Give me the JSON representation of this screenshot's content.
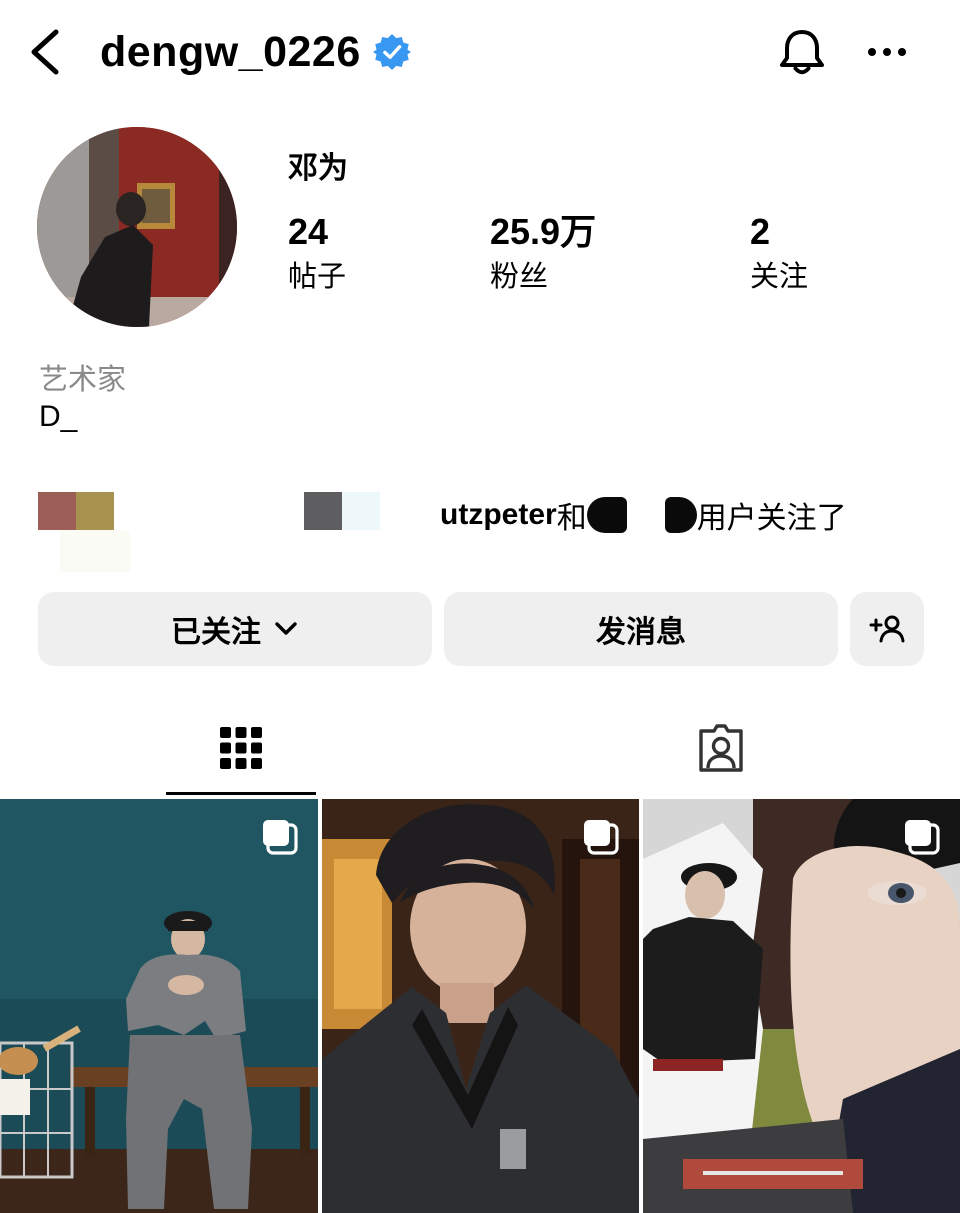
{
  "header": {
    "username": "dengw_0226",
    "icons": {
      "back": "chevron-left-icon",
      "verified": "verified-badge-icon",
      "notifications": "bell-icon",
      "more": "more-horizontal-icon"
    },
    "verified_color": "#3897f0"
  },
  "profile": {
    "display_name": "邓为",
    "stats": [
      {
        "count": "24",
        "label": "帖子"
      },
      {
        "count": "25.9万",
        "label": "粉丝"
      },
      {
        "count": "2",
        "label": "关注"
      }
    ],
    "bio_category": "艺术家",
    "bio_text": "D_"
  },
  "followed_by": {
    "username": "utzpeter",
    "conjunction": "和",
    "suffix": "用户关注了"
  },
  "actions": {
    "following_label": "已关注",
    "message_label": "发消息",
    "suggest_icon": "add-person-icon",
    "button_bg": "#efefef"
  },
  "tabs": [
    {
      "name": "posts-grid",
      "icon": "grid-icon",
      "active": true
    },
    {
      "name": "tagged",
      "icon": "tagged-person-icon",
      "active": false
    }
  ],
  "posts": [
    {
      "icon": "multiple-images-icon"
    },
    {
      "icon": "multiple-images-icon"
    },
    {
      "icon": "multiple-images-icon"
    }
  ]
}
